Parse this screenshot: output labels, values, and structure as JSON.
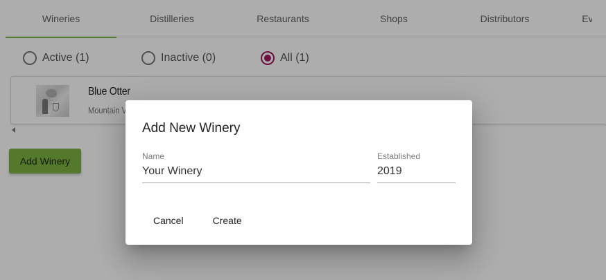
{
  "tabs": [
    "Wineries",
    "Distilleries",
    "Restaurants",
    "Shops",
    "Distributors",
    "Events"
  ],
  "active_tab": "Wineries",
  "filters": {
    "active": "Active (1)",
    "inactive": "Inactive (0)",
    "all": "All (1)",
    "selected": "all"
  },
  "winery_list": [
    {
      "name": "Blue Otter",
      "location": "Mountain V"
    }
  ],
  "add_button_label": "Add Winery",
  "dialog": {
    "title": "Add New Winery",
    "name_label": "Name",
    "name_value": "Your Winery",
    "established_label": "Established",
    "established_value": "2019",
    "cancel_label": "Cancel",
    "create_label": "Create"
  },
  "colors": {
    "accent_green": "#7cb342",
    "radio_selected": "#a0195e"
  }
}
